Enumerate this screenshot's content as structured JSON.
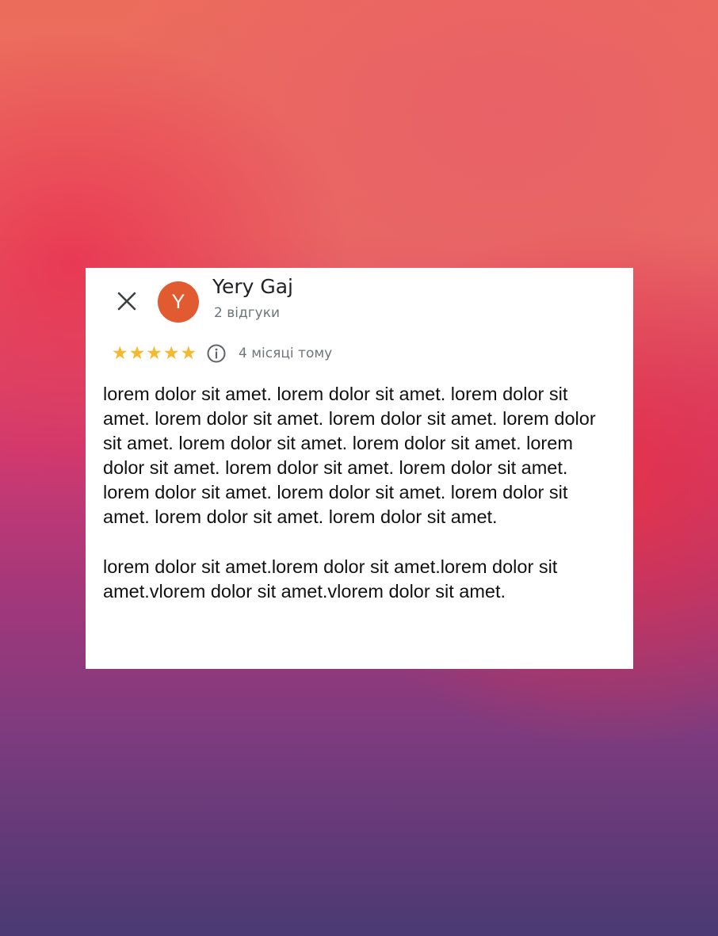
{
  "review": {
    "author_name": "Yery Gaj",
    "avatar_letter": "Y",
    "author_meta": "2 відгуки",
    "rating": 5,
    "stars": [
      "★",
      "★",
      "★",
      "★",
      "★"
    ],
    "time_ago": "4 місяці тому",
    "paragraphs": [
      "lorem dolor sit amet. lorem dolor sit amet. lorem dolor sit amet. lorem dolor sit amet. lorem dolor sit amet. lorem dolor sit amet. lorem dolor sit amet. lorem dolor sit amet. lorem dolor sit amet. lorem dolor sit amet. lorem dolor sit amet. lorem dolor sit amet. lorem dolor sit amet. lorem dolor sit amet. lorem dolor sit amet. lorem dolor sit amet.",
      "lorem dolor sit amet.lorem dolor sit amet.lorem dolor sit amet.vlorem dolor sit amet.vlorem dolor sit amet."
    ]
  },
  "icons": {
    "close": "close-icon",
    "info": "info-icon",
    "star": "star-icon"
  },
  "colors": {
    "avatar_bg": "#e25a2f",
    "star": "#f5b82e",
    "secondary_text": "#70757a",
    "primary_text": "#202124",
    "card_bg": "#ffffff"
  }
}
